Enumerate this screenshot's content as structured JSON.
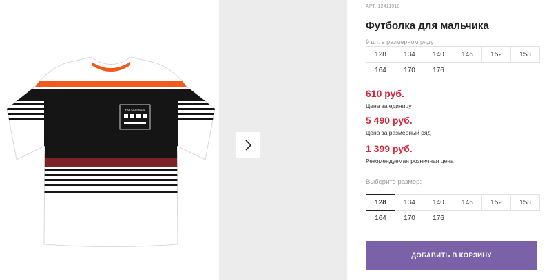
{
  "product": {
    "sku_label": "АРТ. 12411910",
    "title": "Футболка для мальчика",
    "label_text": "FAB CLASSICS"
  },
  "series": {
    "note": "9 шт. в размерном ряду",
    "sizes": [
      "128",
      "134",
      "140",
      "146",
      "152",
      "158",
      "164",
      "170",
      "176"
    ]
  },
  "prices": [
    {
      "value": "610 руб.",
      "caption": "Цена за единицу"
    },
    {
      "value": "5 490 руб.",
      "caption": "Цена за размерный ряд"
    },
    {
      "value": "1 399 руб.",
      "caption": "Рекомендуемая розничная цена"
    }
  ],
  "size_select": {
    "prompt": "Выберите размер:",
    "selected": "128",
    "options": [
      "128",
      "134",
      "140",
      "146",
      "152",
      "158",
      "164",
      "170",
      "176"
    ]
  },
  "cart": {
    "button_label": "ДОБАВИТЬ В КОРЗИНУ"
  },
  "gallery": {
    "next_icon": "chevron-right-icon"
  },
  "colors": {
    "price": "#d5263a",
    "cart_button": "#7a61a8",
    "tshirt_body": "#ffffff",
    "tshirt_black_band": "#151515",
    "tshirt_orange_stripe": "#f05a1e",
    "tshirt_red_band": "#7c2325"
  }
}
